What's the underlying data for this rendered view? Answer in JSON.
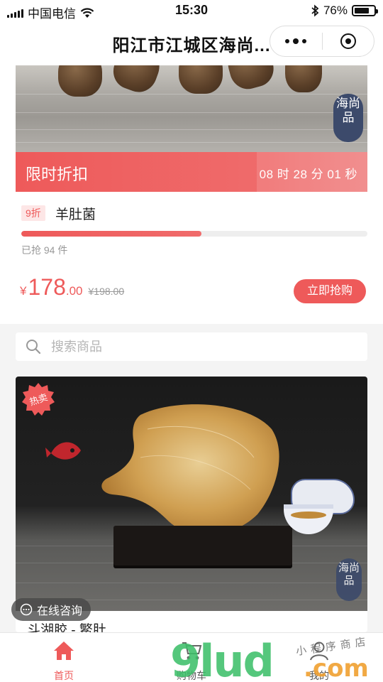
{
  "status_bar": {
    "carrier": "中国电信",
    "time": "15:30",
    "battery": "76%",
    "battery_level": 0.76
  },
  "nav": {
    "title": "阳江市江城区海尚..."
  },
  "flash_sale": {
    "label": "限时折扣",
    "countdown": "08 时 28 分 01 秒",
    "seal_text": "海尚品",
    "discount_tag": "9折",
    "product_name": "羊肚菌",
    "progress": 0.52,
    "sold_text": "已抢 94 件",
    "price_currency": "¥",
    "price_int": "178",
    "price_dec": ".00",
    "original_price": "¥198.00",
    "buy_label": "立即抢购"
  },
  "search": {
    "placeholder": "搜索商品"
  },
  "product": {
    "badge": "热卖",
    "seal_text": "海尚品",
    "title": "斗湖胶 - 鳘肚"
  },
  "consult": {
    "label": "在线咨询"
  },
  "tabs": [
    {
      "label": "首页",
      "icon": "home-icon",
      "active": true
    },
    {
      "label": "购物车",
      "icon": "cart-icon",
      "active": false
    },
    {
      "label": "我的",
      "icon": "user-icon",
      "active": false
    }
  ],
  "watermark": {
    "brand": "9lud",
    "suffix": ".com",
    "script": "小程序商店"
  },
  "colors": {
    "accent": "#ee5a5a",
    "watermark_green": "#3dbf6a",
    "watermark_orange": "#f0a030"
  }
}
